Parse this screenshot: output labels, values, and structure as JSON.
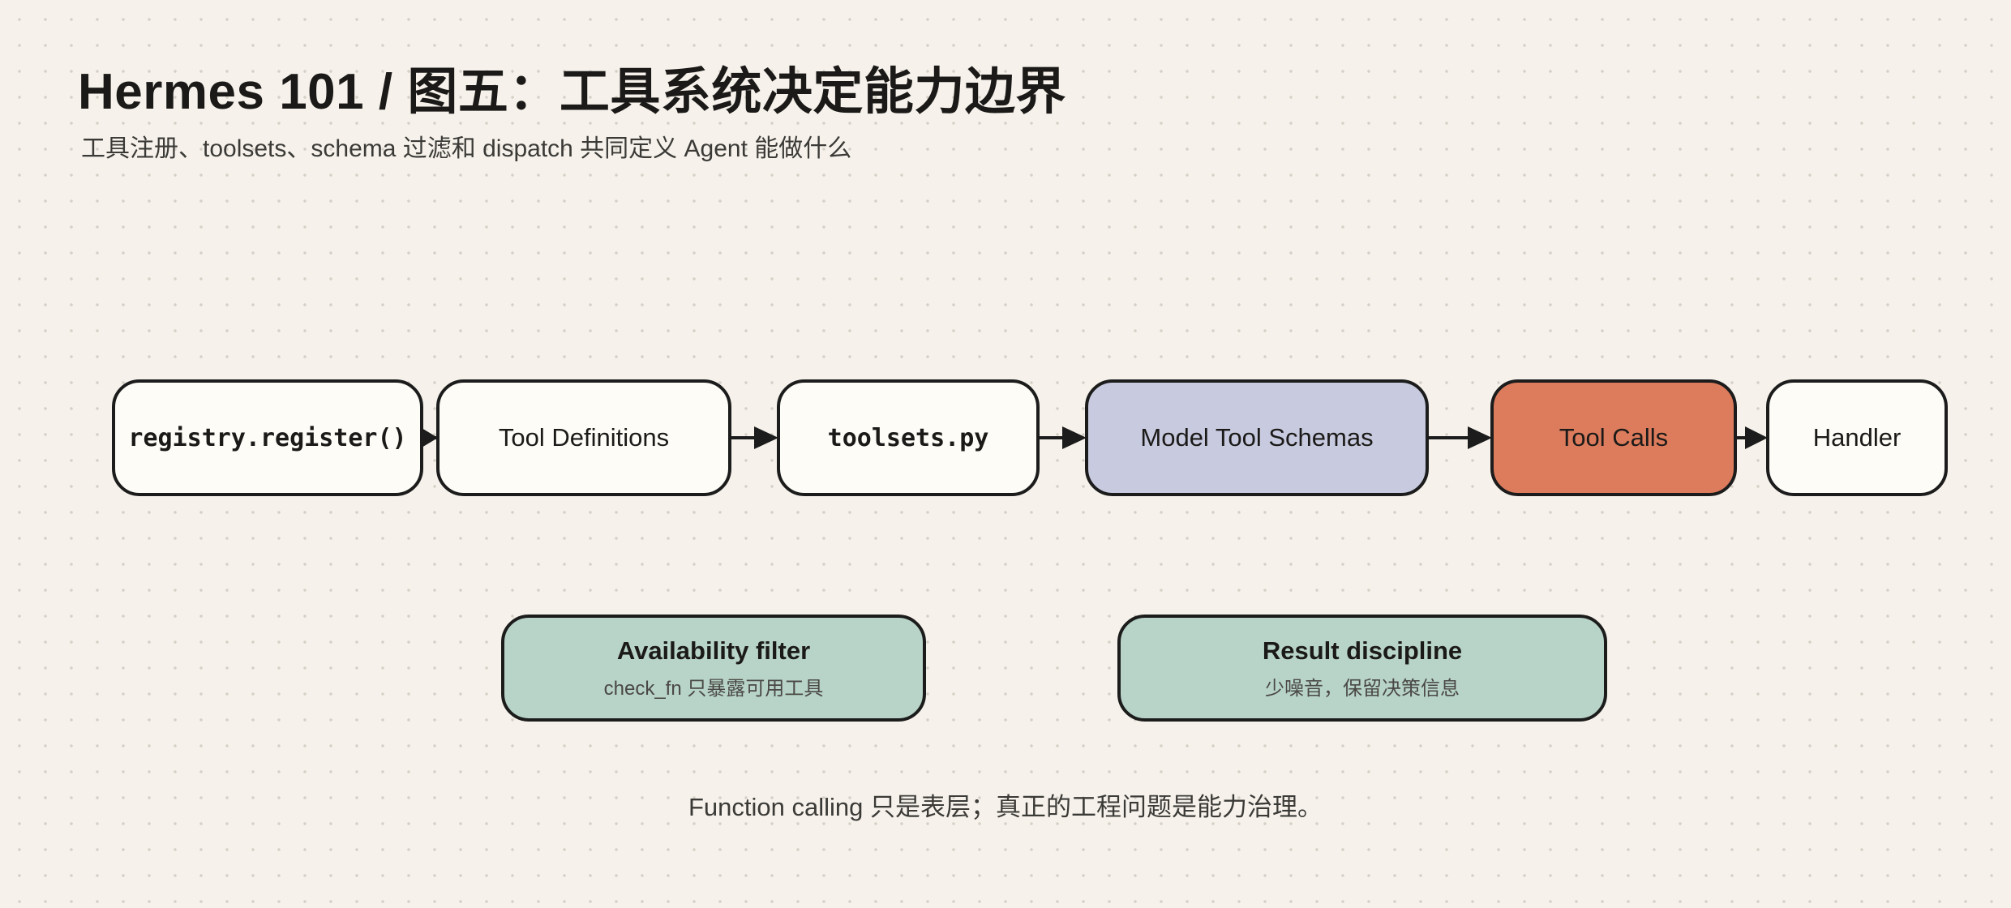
{
  "header": {
    "title": "Hermes 101 / 图五：工具系统决定能力边界",
    "subtitle": "工具注册、toolsets、schema 过滤和 dispatch 共同定义 Agent 能做什么"
  },
  "flow": {
    "nodes": [
      {
        "label": "registry.register()"
      },
      {
        "label": "Tool Definitions"
      },
      {
        "label": "toolsets.py"
      },
      {
        "label": "Model Tool Schemas"
      },
      {
        "label": "Tool Calls"
      },
      {
        "label": "Handler"
      }
    ]
  },
  "notes": [
    {
      "title": "Availability filter",
      "detail": "check_fn 只暴露可用工具"
    },
    {
      "title": "Result discipline",
      "detail": "少噪音，保留决策信息"
    }
  ],
  "footer": {
    "text": "Function calling 只是表层；真正的工程问题是能力治理。"
  },
  "colors": {
    "background": "#f6f2eb",
    "node_default": "#fdfcf7",
    "node_schemas": "#c8cadf",
    "node_tool_calls": "#dc7c5d",
    "note_box": "#b8d4c8",
    "stroke": "#1c1c1c"
  }
}
